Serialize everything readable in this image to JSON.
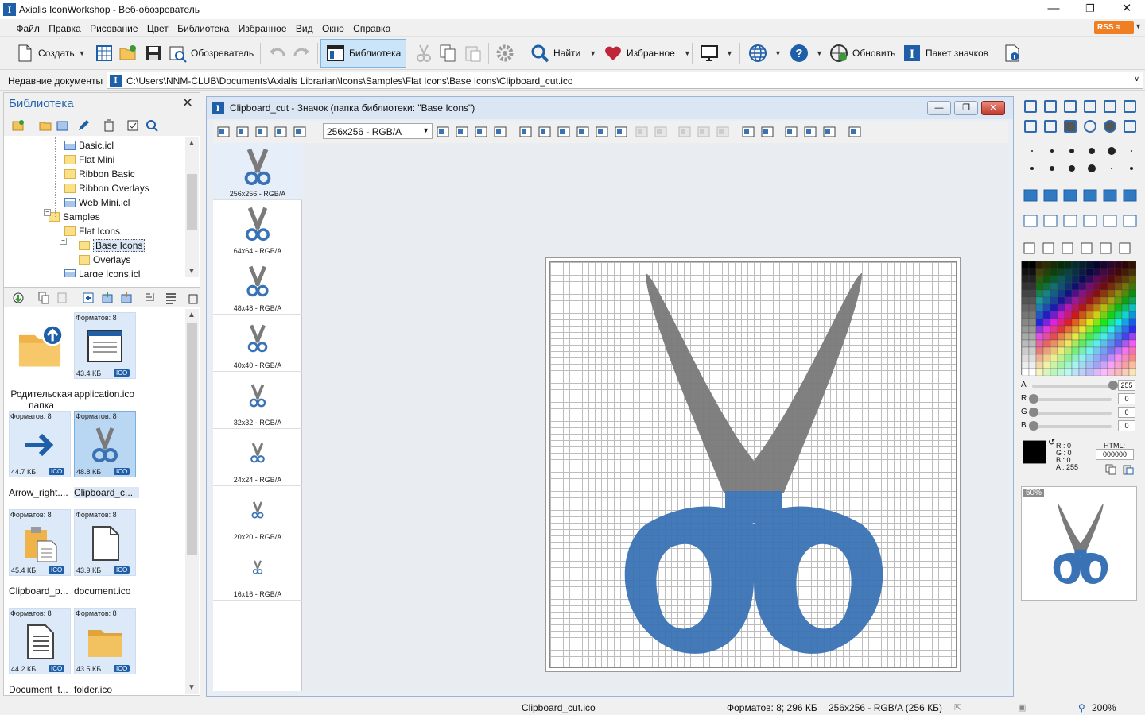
{
  "window": {
    "title": "Axialis IconWorkshop - Веб-обозреватель"
  },
  "menu": [
    "Файл",
    "Правка",
    "Рисование",
    "Цвет",
    "Библиотека",
    "Избранное",
    "Вид",
    "Окно",
    "Справка"
  ],
  "rss": "RSS",
  "toolbar": {
    "create": "Создать",
    "browser": "Обозреватель",
    "library": "Библиотека",
    "find": "Найти",
    "favorites": "Избранное",
    "refresh": "Обновить",
    "iconpack": "Пакет значков"
  },
  "recent": {
    "label": "Недавние документы",
    "path": "C:\\Users\\NNM-CLUB\\Documents\\Axialis Librarian\\Icons\\Samples\\Flat Icons\\Base Icons\\Clipboard_cut.ico"
  },
  "library": {
    "title": "Библиотека",
    "tree": [
      {
        "label": "Basic.icl",
        "kind": "library"
      },
      {
        "label": "Flat Mini",
        "kind": "folder"
      },
      {
        "label": "Ribbon Basic",
        "kind": "folder"
      },
      {
        "label": "Ribbon Overlays",
        "kind": "folder"
      },
      {
        "label": "Web Mini.icl",
        "kind": "library"
      },
      {
        "label": "Samples",
        "kind": "folder"
      },
      {
        "label": "Flat Icons",
        "kind": "folder"
      },
      {
        "label": "Base Icons",
        "kind": "folder",
        "selected": true
      },
      {
        "label": "Overlays",
        "kind": "folder"
      },
      {
        "label": "Large Icons.icl",
        "kind": "library"
      }
    ],
    "files": [
      {
        "name": "Родительская папка",
        "formats": "",
        "size": "",
        "type": "",
        "icon": "parent-folder-icon"
      },
      {
        "name": "application.ico",
        "formats": "Форматов: 8",
        "size": "43.4 КБ",
        "type": "ICO",
        "icon": "application-window-icon"
      },
      {
        "name": "Arrow_right....",
        "formats": "Форматов: 8",
        "size": "44.7 КБ",
        "type": "ICO",
        "icon": "arrow-right-icon"
      },
      {
        "name": "Clipboard_c...",
        "formats": "Форматов: 8",
        "size": "48.8 КБ",
        "type": "ICO",
        "icon": "scissors-icon",
        "selected": true
      },
      {
        "name": "Clipboard_p...",
        "formats": "Форматов: 8",
        "size": "45.4 КБ",
        "type": "ICO",
        "icon": "clipboard-paste-icon"
      },
      {
        "name": "document.ico",
        "formats": "Форматов: 8",
        "size": "43.9 КБ",
        "type": "ICO",
        "icon": "document-icon"
      },
      {
        "name": "Document_t...",
        "formats": "Форматов: 8",
        "size": "44.2 КБ",
        "type": "ICO",
        "icon": "document-text-icon"
      },
      {
        "name": "folder.ico",
        "formats": "Форматов: 8",
        "size": "43.5 КБ",
        "type": "ICO",
        "icon": "folder-icon"
      }
    ]
  },
  "document": {
    "title": "Clipboard_cut - Значок (папка библиотеки: \"Base Icons\")",
    "format_select": "256x256 - RGB/A",
    "formats": [
      "256x256 - RGB/A",
      "64x64 - RGB/A",
      "48x48 - RGB/A",
      "40x40 - RGB/A",
      "32x32 - RGB/A",
      "24x24 - RGB/A",
      "20x20 - RGB/A",
      "16x16 - RGB/A"
    ]
  },
  "colors": {
    "blade": "#7a7a7a",
    "handle": "#3a73b5",
    "accent": "#2566b4"
  },
  "channels": [
    {
      "name": "A",
      "value": "255",
      "level": 1.0
    },
    {
      "name": "R",
      "value": "0",
      "level": 0
    },
    {
      "name": "G",
      "value": "0",
      "level": 0
    },
    {
      "name": "B",
      "value": "0",
      "level": 0
    }
  ],
  "colorinfo": {
    "r": "R : 0",
    "g": "G : 0",
    "b": "B : 0",
    "a": "A : 255",
    "html_label": "HTML:",
    "html_value": "000000"
  },
  "preview": {
    "zoom": "50%"
  },
  "status": {
    "file": "Clipboard_cut.ico",
    "formats": "Форматов: 8; 296 КБ",
    "current": "256x256 - RGB/A (256 КБ)",
    "zoom": "200%"
  }
}
